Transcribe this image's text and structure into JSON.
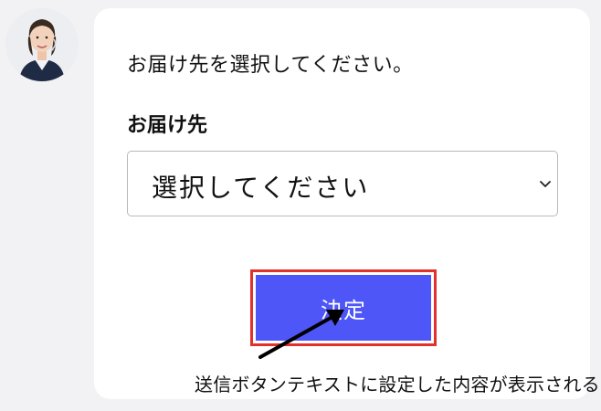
{
  "avatar": {
    "icon": "operator-headset-avatar"
  },
  "form": {
    "prompt": "お届け先を選択してください。",
    "field_label": "お届け先",
    "select": {
      "value": "選択してください",
      "icon": "chevron-down-icon"
    },
    "submit_label": "決定",
    "submit_color": "#4f56f8",
    "highlight_color": "#e0312a"
  },
  "annotation": {
    "text": "送信ボタンテキストに設定した内容が表示される",
    "icon": "arrow-icon"
  }
}
